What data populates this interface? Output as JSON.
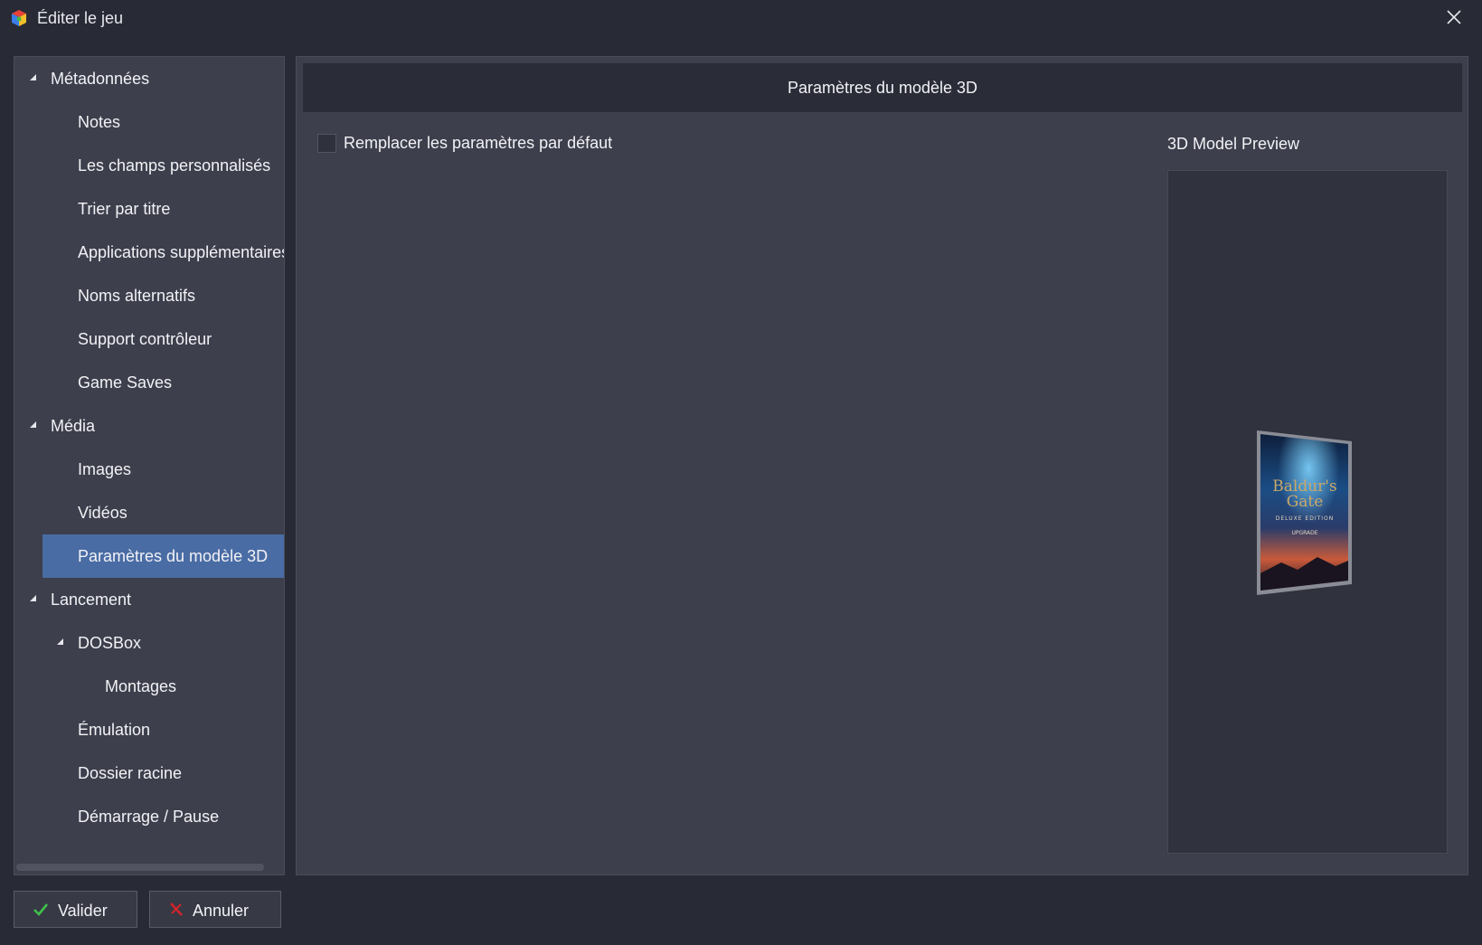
{
  "window": {
    "title": "Éditer le jeu"
  },
  "sidebar": {
    "items": [
      {
        "label": "Métadonnées",
        "level": 0,
        "expanded": true
      },
      {
        "label": "Notes",
        "level": 1
      },
      {
        "label": "Les champs personnalisés",
        "level": 1
      },
      {
        "label": "Trier par titre",
        "level": 1
      },
      {
        "label": "Applications supplémentaires",
        "level": 1
      },
      {
        "label": "Noms alternatifs",
        "level": 1
      },
      {
        "label": "Support contrôleur",
        "level": 1
      },
      {
        "label": "Game Saves",
        "level": 1
      },
      {
        "label": "Média",
        "level": 0,
        "expanded": true
      },
      {
        "label": "Images",
        "level": 1
      },
      {
        "label": "Vidéos",
        "level": 1
      },
      {
        "label": "Paramètres du modèle 3D",
        "level": 1,
        "selected": true
      },
      {
        "label": "Lancement",
        "level": 0,
        "expanded": true
      },
      {
        "label": "DOSBox",
        "level": 1,
        "expanded": true
      },
      {
        "label": "Montages",
        "level": 2
      },
      {
        "label": "Émulation",
        "level": 1
      },
      {
        "label": "Dossier racine",
        "level": 1
      },
      {
        "label": "Démarrage / Pause",
        "level": 1
      }
    ]
  },
  "main": {
    "section_title": "Paramètres du modèle 3D",
    "override_checkbox": {
      "label": "Remplacer les paramètres par défaut",
      "checked": false
    },
    "preview_title": "3D Model Preview",
    "box_art": {
      "title_line1": "Baldur's",
      "title_line2": "Gate",
      "subtitle": "DELUXE EDITION",
      "tag": "UPGRADE"
    }
  },
  "footer": {
    "validate_label": "Valider",
    "cancel_label": "Annuler"
  },
  "colors": {
    "window_bg": "#282a35",
    "panel_bg": "#3d3f4c",
    "header_bg": "#2a2c37",
    "selected_bg": "#4a6ca4",
    "check_green": "#3ec24a",
    "cancel_red": "#d0242a"
  },
  "icons": {
    "app": "app-cube-icon",
    "close": "close-icon",
    "validate": "checkmark-icon",
    "cancel": "cross-icon",
    "expand": "triangle-expanded-icon"
  }
}
